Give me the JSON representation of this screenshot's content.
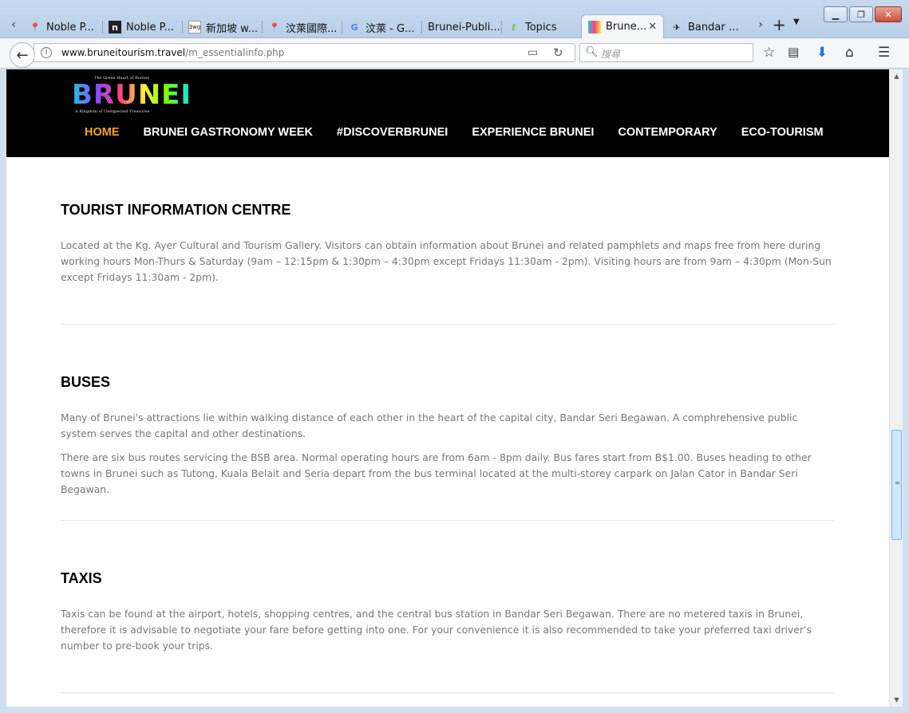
{
  "browser": {
    "tabs": [
      {
        "title": "Noble P...",
        "favicon": "maps-icon",
        "favicon_glyph": "📍",
        "active": false
      },
      {
        "title": "Noble P...",
        "favicon": "n-logo-icon",
        "favicon_glyph": "n",
        "active": false
      },
      {
        "title": "新加坡 w...",
        "favicon": "3wg-icon",
        "favicon_glyph": "3wg",
        "active": false
      },
      {
        "title": "汶萊國際...",
        "favicon": "maps-icon",
        "favicon_glyph": "📍",
        "active": false
      },
      {
        "title": "汶萊 - G...",
        "favicon": "google-icon",
        "favicon_glyph": "G",
        "active": false
      },
      {
        "title": "Brunei-Publi...",
        "favicon": "",
        "favicon_glyph": "",
        "active": false
      },
      {
        "title": "Topics",
        "favicon": "leaf-icon",
        "favicon_glyph": "ℓ",
        "active": false
      },
      {
        "title": "Brune...",
        "favicon": "brunei-icon",
        "favicon_glyph": "",
        "active": true
      },
      {
        "title": "Bandar S...",
        "favicon": "plane-icon",
        "favicon_glyph": "✈",
        "active": false
      }
    ],
    "url_domain": "www.bruneitourism.travel",
    "url_path": "/m_essentialinfo.php",
    "search_placeholder": "搜尋"
  },
  "site": {
    "logo_tagline": "The Green Heart of Borneo",
    "logo_word": "BRUNEI",
    "logo_sub": "A Kingdom of Unexpected Treasures",
    "nav": [
      "HOME",
      "BRUNEI GASTRONOMY WEEK",
      "#DISCOVERBRUNEI",
      "EXPERIENCE BRUNEI",
      "CONTEMPORARY",
      "ECO-TOURISM"
    ],
    "nav_active_color": "#f5a623"
  },
  "sections": {
    "tourist": {
      "title": "TOURIST INFORMATION CENTRE",
      "p1": "Located at the Kg. Ayer Cultural and Tourism Gallery. Visitors can obtain information about Brunei and related pamphlets and maps free from here during working hours Mon-Thurs & Saturday (9am – 12:15pm & 1:30pm – 4:30pm except Fridays 11:30am - 2pm). Visiting hours are from 9am – 4:30pm (Mon-Sun except Fridays 11:30am - 2pm)."
    },
    "buses": {
      "title": "BUSES",
      "p1": "Many of Brunei's attractions lie within walking distance of each other in the heart of the capital city, Bandar Seri Begawan. A comphrehensive public system serves the capital and other destinations.",
      "p2": "There are six bus routes servicing the BSB area. Normal operating hours are from 6am - 8pm daily. Bus fares start from B$1.00. Buses heading to other towns in Brunei such as Tutong, Kuala Belait and Seria depart from the bus terminal located at the multi-storey carpark on Jalan Cator in Bandar Seri Begawan."
    },
    "taxis": {
      "title": "TAXIS",
      "p1": "Taxis can be found at the airport, hotels, shopping centres, and the central bus station in Bandar Seri Begawan. There are no metered taxis in Brunei, therefore it is advisable to negotiate your fare before getting into one. For your convenience it is also recommended to take your preferred taxi driver's number to pre-book your trips."
    }
  }
}
